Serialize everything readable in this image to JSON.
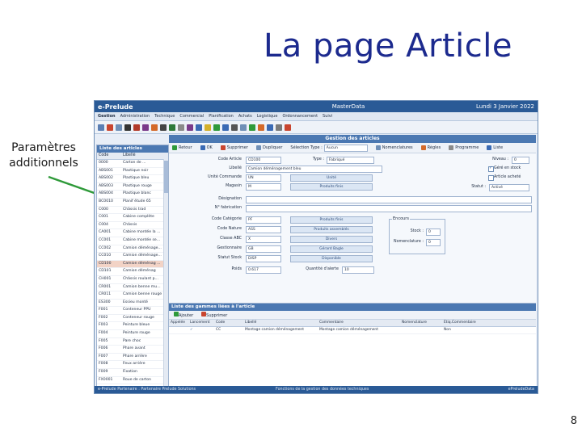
{
  "slide": {
    "title": "La page Article",
    "callout": "Paramètres additionnels",
    "page_number": "8"
  },
  "app": {
    "name": "e-Prelude",
    "section": "MasterData",
    "date": "Lundi 3 Janvier 2022",
    "menu": [
      "Gestion",
      "Administration",
      "Technique",
      "Commercial",
      "Planification",
      "Achats",
      "Logistique",
      "Ordonnancement",
      "Suivi"
    ],
    "left_panel": {
      "title": "Liste des articles",
      "col_code": "Code",
      "col_label": "Libellé",
      "rows": [
        {
          "code": "0000",
          "label": "Carton de ..."
        },
        {
          "code": "ABS001",
          "label": "Plastique noir"
        },
        {
          "code": "ABS002",
          "label": "Plastique bleu"
        },
        {
          "code": "ABS003",
          "label": "Plastique rouge"
        },
        {
          "code": "ABS004",
          "label": "Plastique blanc"
        },
        {
          "code": "BC0010",
          "label": "Planif étude 65"
        },
        {
          "code": "C000",
          "label": "Châssis trad"
        },
        {
          "code": "C001",
          "label": "Cabine complète"
        },
        {
          "code": "C004",
          "label": "Châssis"
        },
        {
          "code": "CA001",
          "label": "Cabine montée la ..."
        },
        {
          "code": "CC001",
          "label": "Cabine montée se..."
        },
        {
          "code": "CC002",
          "label": "Camion déménage..."
        },
        {
          "code": "CC010",
          "label": "Camion déménage..."
        },
        {
          "code": "CD100",
          "label": "Camion déménag ...",
          "selected": true
        },
        {
          "code": "CD101",
          "label": "Camion déménag"
        },
        {
          "code": "CH001",
          "label": "Châssis roulant p..."
        },
        {
          "code": "CR001",
          "label": "Camion benne mu..."
        },
        {
          "code": "CR011",
          "label": "Camion benne rouge"
        },
        {
          "code": "ES300",
          "label": "Essieu monté"
        },
        {
          "code": "F001",
          "label": "Conteneur PPU"
        },
        {
          "code": "F002",
          "label": "Conteneur rouge"
        },
        {
          "code": "F003",
          "label": "Peinture bleue"
        },
        {
          "code": "F004",
          "label": "Peinture rouge"
        },
        {
          "code": "F005",
          "label": "Pare choc"
        },
        {
          "code": "F006",
          "label": "Phare avant"
        },
        {
          "code": "F007",
          "label": "Phare arrière"
        },
        {
          "code": "F008",
          "label": "Feux arrière"
        },
        {
          "code": "F009",
          "label": "Fixation"
        },
        {
          "code": "FX0001",
          "label": "Roue de carton"
        }
      ]
    },
    "main": {
      "title": "Gestion des articles",
      "actions": [
        "Retour",
        "OK",
        "Supprimer",
        "Dupliquer"
      ],
      "selection_label": "Sélection Type :",
      "selection_value": "Aucun",
      "actions_right": [
        "Nomenclatures",
        "Règles",
        "Programme",
        "Liste"
      ],
      "fields": {
        "code_article_label": "Code Article",
        "code_article_value": "CD100",
        "type_label": "Type :",
        "type_value": "Fabriqué",
        "niveau_label": "Niveau :",
        "niveau_value": "0",
        "libelle_label": "Libellé",
        "libelle_value": "Camion déménagement bleu",
        "unite_label": "Unité Commande",
        "unite_value": "UN",
        "unite_btn": "Unité",
        "magasin_label": "Magasin",
        "magasin_value": "M",
        "magasin_btn": "Produits finis",
        "statut_label": "Statut :",
        "statut_value": "Activé",
        "check_gere": "Géré en stock",
        "check_achete": "Article acheté",
        "designation_label": "Désignation",
        "designation_value": "",
        "nfab_label": "N° fabrication",
        "nfab_value": "",
        "categorie_label": "Code Catégorie",
        "categorie_value": "PF",
        "categorie_btn": "Produits finis",
        "nature_label": "Code Nature",
        "nature_value": "ASS",
        "nature_btn": "Produits assemblés",
        "abc_label": "Classe ABC",
        "abc_value": "X",
        "abc_btn": "Divers",
        "gestionnaire_label": "Gestionnaire",
        "gestionnaire_value": "GB",
        "gestionnaire_btn": "Gérard Bagle",
        "stock_label": "Statut Stock",
        "stock_value": "DISP",
        "stock_btn": "Disponible",
        "poids_label": "Poids",
        "poids_value": "0.617",
        "quantite_label": "Quantité d'alerte",
        "quantite_value": "10",
        "encours_title": "Encours",
        "encours_stock_label": "Stock :",
        "encours_stock_value": "0",
        "encours_nomen_label": "Nomenclature :",
        "encours_nomen_value": "0"
      }
    },
    "gammes": {
      "title": "Liste des gammes liées à l'article",
      "actions": [
        "Ajouter",
        "Supprimer"
      ],
      "columns": [
        "Appelée",
        "Lancement",
        "Code",
        "Libellé",
        "Commentaire",
        "Nomenclature",
        "Étiq.Commentaire"
      ],
      "rows": [
        {
          "appelee": "",
          "lancement": "✓",
          "code": "CC",
          "libelle": "Montage camion déménagement",
          "commentaire": "Montage camion déménagement",
          "nomenclature": "",
          "etiq": "Non"
        }
      ]
    },
    "status": {
      "left": "e-Prelude Partenaire : Partenaire Prelude Solutions",
      "middle": "Fonctions de la gestion des données techniques",
      "right": "ePreludeData"
    }
  },
  "colors": {
    "title_blue": "#1c2a8e",
    "arrow_green": "#2f9a3a",
    "app_blue": "#2a5a96"
  }
}
